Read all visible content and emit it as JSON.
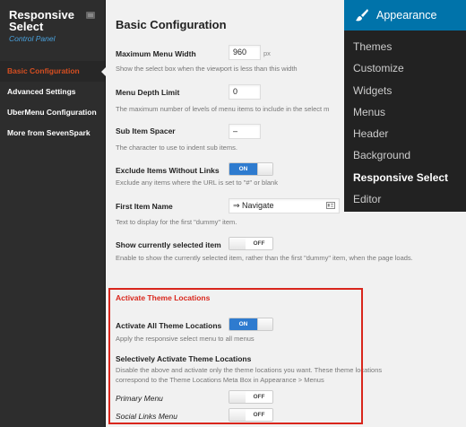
{
  "sidebar": {
    "brand_title": "Responsive Select",
    "brand_line1": "Responsive",
    "brand_line2": "Select",
    "brand_subtitle": "Control Panel",
    "items": [
      {
        "label": "Basic Configuration",
        "active": true
      },
      {
        "label": "Advanced Settings",
        "active": false
      },
      {
        "label": "UberMenu Configuration",
        "active": false
      },
      {
        "label": "More from SevenSpark",
        "active": false
      }
    ]
  },
  "main": {
    "title": "Basic Configuration",
    "max_width": {
      "label": "Maximum Menu Width",
      "value": "960",
      "unit": "px",
      "desc": "Show the select box when the viewport is less than this width"
    },
    "depth_limit": {
      "label": "Menu Depth Limit",
      "value": "0",
      "desc": "The maximum number of levels of menu items to include in the select m"
    },
    "sub_spacer": {
      "label": "Sub Item Spacer",
      "value": "–",
      "desc": "The character to use to indent sub items."
    },
    "exclude_links": {
      "label": "Exclude Items Without Links",
      "state": "ON",
      "desc": "Exclude any items where the URL is set to \"#\" or blank"
    },
    "first_item": {
      "label": "First Item Name",
      "value": "⇒ Navigate",
      "desc": "Text to display for the first \"dummy\" item."
    },
    "show_selected": {
      "label": "Show currently selected item",
      "state": "OFF",
      "desc": "Enable to show the currently selected item, rather than the first \"dummy\" item, when the page loads."
    },
    "theme_locations": {
      "section_title": "Activate Theme Locations",
      "activate_all": {
        "label": "Activate All Theme Locations",
        "state": "ON",
        "desc": "Apply the responsive select menu to all menus"
      },
      "selective": {
        "label": "Selectively Activate Theme Locations",
        "desc_line1": "Disable the above and activate only the theme locations you want. These theme locations",
        "desc_line2": "correspond to the Theme Locations Meta Box in Appearance > Menus"
      },
      "locations": [
        {
          "label": "Primary Menu",
          "state": "OFF"
        },
        {
          "label": "Social Links Menu",
          "state": "OFF"
        }
      ]
    }
  },
  "appearance_menu": {
    "title": "Appearance",
    "items": [
      {
        "label": "Themes",
        "current": false
      },
      {
        "label": "Customize",
        "current": false
      },
      {
        "label": "Widgets",
        "current": false
      },
      {
        "label": "Menus",
        "current": false
      },
      {
        "label": "Header",
        "current": false
      },
      {
        "label": "Background",
        "current": false
      },
      {
        "label": "Responsive Select",
        "current": true
      },
      {
        "label": "Editor",
        "current": false
      }
    ]
  },
  "colors": {
    "accent_blue": "#2e7bcf",
    "wp_blue": "#0073aa",
    "highlight_red": "#d9261c",
    "active_nav": "#d54e21"
  },
  "icons": {
    "brand": "gear-icon",
    "appearance": "paintbrush-icon",
    "first_item_input": "card-icon"
  }
}
